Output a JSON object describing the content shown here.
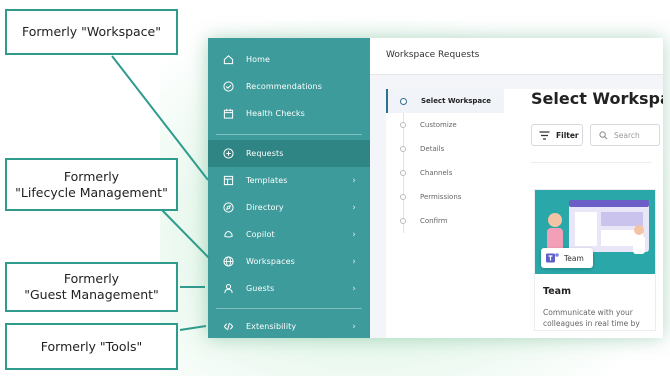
{
  "callouts": [
    {
      "lines": [
        "Formerly \"Workspace\""
      ]
    },
    {
      "lines": [
        "Formerly",
        "\"Lifecycle Management\""
      ]
    },
    {
      "lines": [
        "Formerly",
        "\"Guest Management\""
      ]
    },
    {
      "lines": [
        "Formerly \"Tools\""
      ]
    }
  ],
  "sidebar": {
    "items": [
      {
        "label": "Home",
        "icon": "home-icon",
        "chevron": false
      },
      {
        "label": "Recommendations",
        "icon": "check-circle-icon",
        "chevron": false
      },
      {
        "label": "Health Checks",
        "icon": "calendar-check-icon",
        "chevron": false
      },
      {
        "label": "Requests",
        "icon": "plus-circle-icon",
        "chevron": false,
        "active": true
      },
      {
        "label": "Templates",
        "icon": "template-icon",
        "chevron": true
      },
      {
        "label": "Directory",
        "icon": "compass-icon",
        "chevron": true
      },
      {
        "label": "Copilot",
        "icon": "copilot-icon",
        "chevron": true
      },
      {
        "label": "Workspaces",
        "icon": "globe-icon",
        "chevron": true
      },
      {
        "label": "Guests",
        "icon": "guests-icon",
        "chevron": true
      },
      {
        "label": "Extensibility",
        "icon": "code-icon",
        "chevron": true
      }
    ],
    "chevron_glyph": "›"
  },
  "header": {
    "title": "Workspace Requests"
  },
  "steps": [
    {
      "label": "Select Workspace",
      "active": true
    },
    {
      "label": "Customize"
    },
    {
      "label": "Details"
    },
    {
      "label": "Channels"
    },
    {
      "label": "Permissions"
    },
    {
      "label": "Confirm"
    }
  ],
  "panel": {
    "title": "Select Workspa",
    "filter_label": "Filter",
    "search_placeholder": "Search"
  },
  "card": {
    "badge_label": "Team",
    "title": "Team",
    "description": "Communicate with your colleagues in real time by"
  },
  "colors": {
    "sidebar": "#3d9b9b",
    "sidebar_active": "#2f8484",
    "callout_border": "#2e9b8c",
    "accent": "#2f6f8f"
  }
}
